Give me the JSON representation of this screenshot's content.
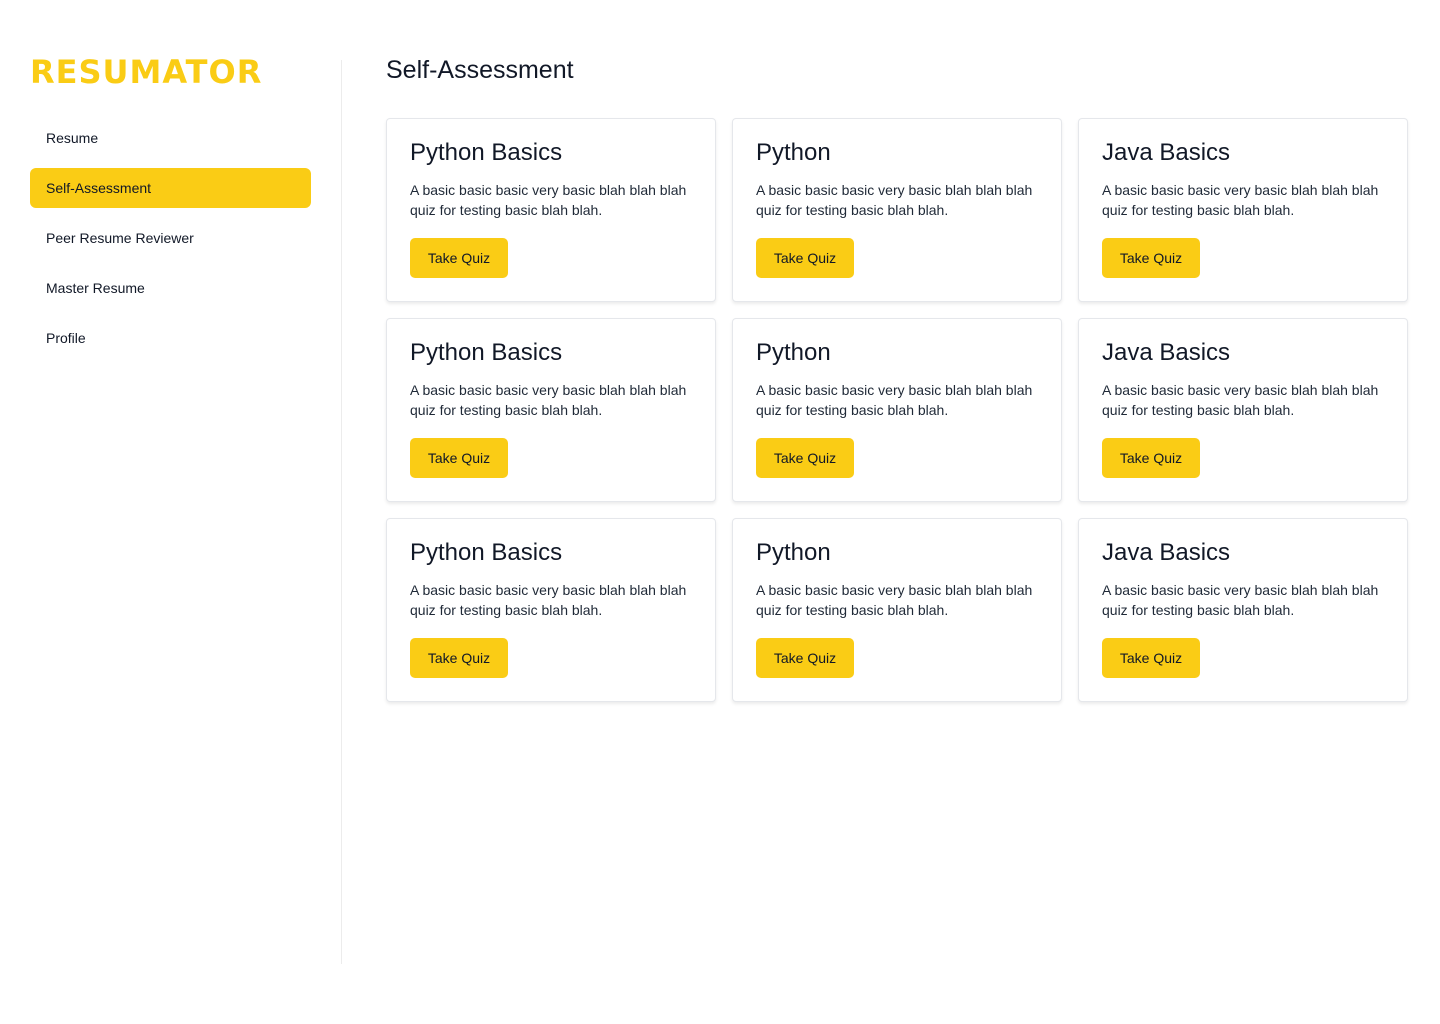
{
  "brand": {
    "logo_text": "RESUMATOR",
    "accent_color": "#facc15"
  },
  "sidebar": {
    "items": [
      {
        "label": "Resume",
        "active": false
      },
      {
        "label": "Self-Assessment",
        "active": true
      },
      {
        "label": "Peer Resume Reviewer",
        "active": false
      },
      {
        "label": "Master Resume",
        "active": false
      },
      {
        "label": "Profile",
        "active": false
      }
    ]
  },
  "main": {
    "title": "Self-Assessment",
    "cards": [
      {
        "title": "Python Basics",
        "description": "A basic basic basic very basic blah blah blah quiz for testing basic blah blah.",
        "button": "Take Quiz"
      },
      {
        "title": "Python",
        "description": "A basic basic basic very basic blah blah blah quiz for testing basic blah blah.",
        "button": "Take Quiz"
      },
      {
        "title": "Java Basics",
        "description": "A basic basic basic very basic blah blah blah quiz for testing basic blah blah.",
        "button": "Take Quiz"
      },
      {
        "title": "Python Basics",
        "description": "A basic basic basic very basic blah blah blah quiz for testing basic blah blah.",
        "button": "Take Quiz"
      },
      {
        "title": "Python",
        "description": "A basic basic basic very basic blah blah blah quiz for testing basic blah blah.",
        "button": "Take Quiz"
      },
      {
        "title": "Java Basics",
        "description": "A basic basic basic very basic blah blah blah quiz for testing basic blah blah.",
        "button": "Take Quiz"
      },
      {
        "title": "Python Basics",
        "description": "A basic basic basic very basic blah blah blah quiz for testing basic blah blah.",
        "button": "Take Quiz"
      },
      {
        "title": "Python",
        "description": "A basic basic basic very basic blah blah blah quiz for testing basic blah blah.",
        "button": "Take Quiz"
      },
      {
        "title": "Java Basics",
        "description": "A basic basic basic very basic blah blah blah quiz for testing basic blah blah.",
        "button": "Take Quiz"
      }
    ]
  }
}
